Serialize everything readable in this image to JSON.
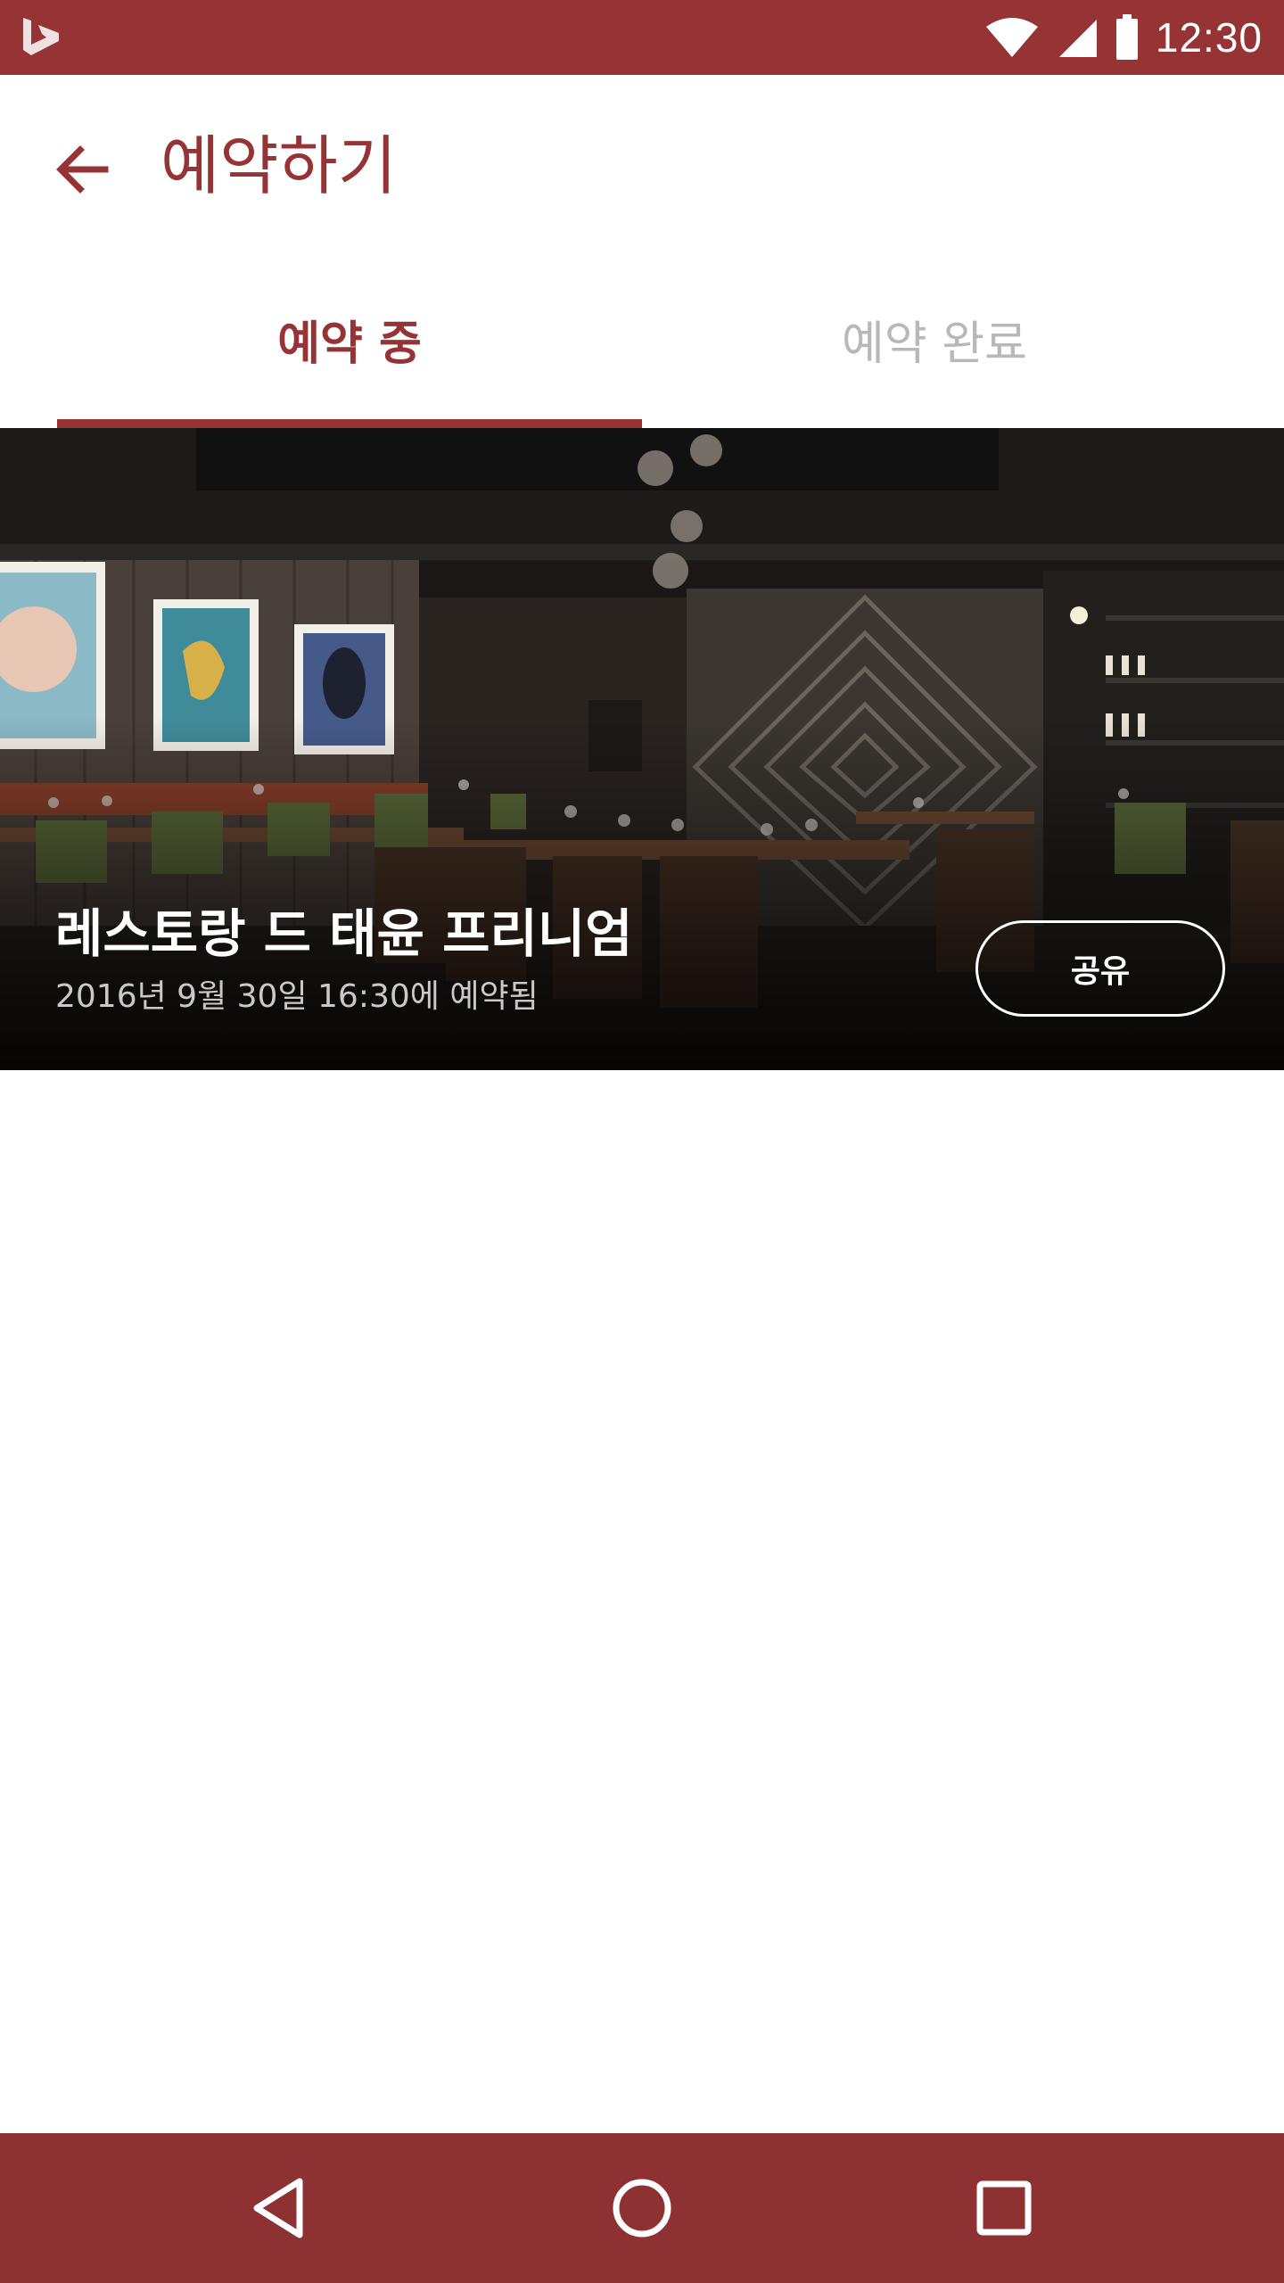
{
  "status_bar": {
    "time": "12:30",
    "icons": [
      "bing-logo-icon",
      "wifi-icon",
      "cellular-signal-icon",
      "battery-icon"
    ]
  },
  "app_bar": {
    "title": "예약하기",
    "back_icon": "arrow-back-icon"
  },
  "tabs": [
    {
      "label": "예약 중",
      "selected": true
    },
    {
      "label": "예약 완료",
      "selected": false
    }
  ],
  "reservation": {
    "restaurant_name": "레스토랑 드 태윤 프리니엄",
    "reserved_at": "2016년 9월 30일 16:30에 예약됨",
    "share_label": "공유",
    "photo": "restaurant-interior-photo"
  },
  "nav_bar": {
    "icons": [
      "nav-back-icon",
      "nav-home-icon",
      "nav-recents-icon"
    ]
  },
  "colors": {
    "brand": "#953335",
    "nav_bar": "#8e3133",
    "tab_inactive": "#b8b8b8",
    "background": "#ffffff"
  }
}
